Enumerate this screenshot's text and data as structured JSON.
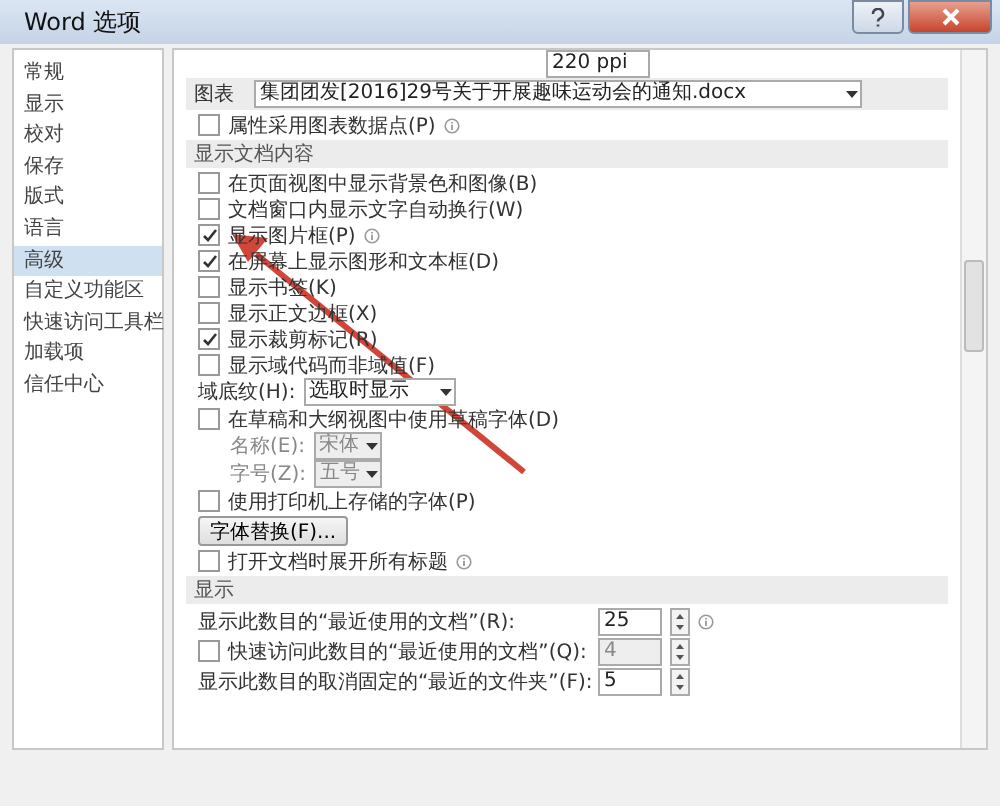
{
  "window": {
    "title": "Word 选项"
  },
  "sidebar": {
    "items": [
      {
        "label": "常规",
        "selected": false
      },
      {
        "label": "显示",
        "selected": false
      },
      {
        "label": "校对",
        "selected": false
      },
      {
        "label": "保存",
        "selected": false
      },
      {
        "label": "版式",
        "selected": false
      },
      {
        "label": "语言",
        "selected": false
      },
      {
        "label": "高级",
        "selected": true
      },
      {
        "label": "自定义功能区",
        "selected": false
      },
      {
        "label": "快速访问工具栏",
        "selected": false
      },
      {
        "label": "加载项",
        "selected": false
      },
      {
        "label": "信任中心",
        "selected": false
      }
    ]
  },
  "content": {
    "rows": [
      {
        "kind": "cut-field",
        "value": "220 ppi"
      },
      {
        "kind": "doc-select",
        "label": "图表",
        "value": "集团团发[2016]29号关于开展趣味运动会的通知.docx"
      },
      {
        "kind": "checkbox",
        "label": "属性采用图表数据点(P)",
        "checked": false,
        "info": true
      },
      {
        "kind": "section",
        "label": "显示文档内容"
      },
      {
        "kind": "checkbox",
        "label": "在页面视图中显示背景色和图像(B)",
        "checked": false
      },
      {
        "kind": "checkbox",
        "label": "文档窗口内显示文字自动换行(W)",
        "checked": false
      },
      {
        "kind": "checkbox",
        "label": "显示图片框(P)",
        "checked": true,
        "info": true
      },
      {
        "kind": "checkbox",
        "label": "在屏幕上显示图形和文本框(D)",
        "checked": true
      },
      {
        "kind": "checkbox",
        "label": "显示书签(K)",
        "checked": false
      },
      {
        "kind": "checkbox",
        "label": "显示正文边框(X)",
        "checked": false
      },
      {
        "kind": "checkbox",
        "label": "显示裁剪标记(R)",
        "checked": true
      },
      {
        "kind": "checkbox",
        "label": "显示域代码而非域值(F)",
        "checked": false
      },
      {
        "kind": "select",
        "label": "域底纹(H):",
        "value": "选取时显示",
        "disabled": false
      },
      {
        "kind": "checkbox",
        "label": "在草稿和大纲视图中使用草稿字体(D)",
        "checked": false
      },
      {
        "kind": "sub-select",
        "label": "名称(E):",
        "value": "宋体",
        "disabled": true
      },
      {
        "kind": "sub-select",
        "label": "字号(Z):",
        "value": "五号",
        "disabled": true
      },
      {
        "kind": "checkbox",
        "label": "使用打印机上存储的字体(P)",
        "checked": false
      },
      {
        "kind": "button",
        "label": "字体替换(F)..."
      },
      {
        "kind": "checkbox",
        "label": "打开文档时展开所有标题",
        "checked": false,
        "info": true
      },
      {
        "kind": "section",
        "label": "显示"
      },
      {
        "kind": "spin",
        "label": "显示此数目的“最近使用的文档”(R):",
        "value": "25",
        "info": true,
        "disabled": false
      },
      {
        "kind": "check-spin",
        "label": "快速访问此数目的“最近使用的文档”(Q):",
        "value": "4",
        "checked": false,
        "disabled": true
      },
      {
        "kind": "spin",
        "label": "显示此数目的取消固定的“最近的文件夹”(F):",
        "value": "5",
        "disabled": false
      }
    ]
  }
}
